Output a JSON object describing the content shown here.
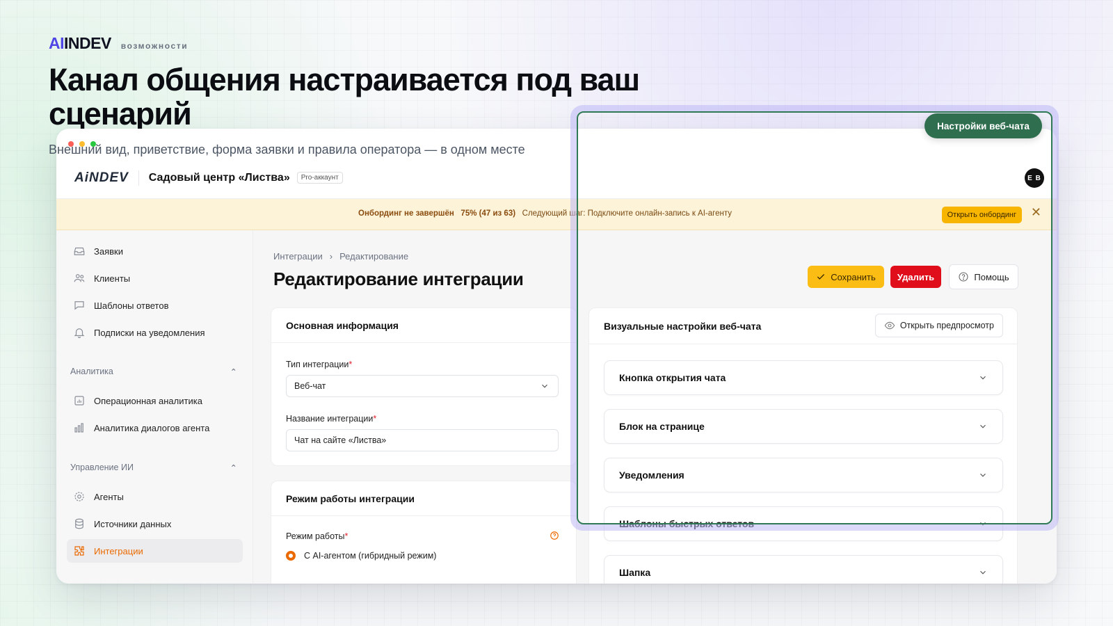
{
  "brand": {
    "logo_ai": "AI",
    "logo_rest": "INDEV",
    "tag": "возможности"
  },
  "hero": {
    "title": "Канал общения настраивается под ваш сценарий",
    "subtitle": "Внешний вид, приветствие, форма заявки и правила оператора — в одном месте"
  },
  "window_controls": {
    "colors": [
      "#ff5f57",
      "#febc2e",
      "#28c840"
    ]
  },
  "app": {
    "logo_ai": "Ai",
    "logo_rest": "NDEV",
    "org_name": "Садовый центр «Листва»",
    "plan_badge": "Pro-аккаунт",
    "avatar_initials": "E B"
  },
  "banner": {
    "title": "Онбординг не завершён",
    "progress": "75% (47 из 63)",
    "progress_value": 0.75,
    "next_step": "Следующий шаг: Подключите онлайн-запись к AI-агенту",
    "button": "Открыть онбординг",
    "close": "✕"
  },
  "sidebar": {
    "items": [
      {
        "label": "Заявки",
        "icon": "inbox-icon"
      },
      {
        "label": "Клиенты",
        "icon": "users-icon"
      },
      {
        "label": "Шаблоны ответов",
        "icon": "chat-icon"
      },
      {
        "label": "Подписки на уведомления",
        "icon": "bell-icon"
      }
    ],
    "analytics": {
      "title": "Аналитика",
      "items": [
        {
          "label": "Операционная аналитика",
          "icon": "chart-icon"
        },
        {
          "label": "Аналитика диалогов агента",
          "icon": "bars-icon"
        }
      ]
    },
    "ai": {
      "title": "Управление ИИ",
      "items": [
        {
          "label": "Агенты",
          "icon": "gear-icon"
        },
        {
          "label": "Источники данных",
          "icon": "database-icon"
        },
        {
          "label": "Интеграции",
          "icon": "puzzle-icon",
          "active": true
        }
      ]
    }
  },
  "page": {
    "breadcrumb": [
      "Интеграции",
      "Редактирование"
    ],
    "breadcrumb_sep": "›",
    "title": "Редактирование интеграции",
    "actions": {
      "save": "Сохранить",
      "delete": "Удалить",
      "help": "Помощь"
    }
  },
  "basic_info": {
    "title": "Основная информация",
    "type_label": "Тип интеграции",
    "type_value": "Веб-чат",
    "name_label": "Название интеграции",
    "name_value": "Чат на сайте «Листва»",
    "required_mark": "*"
  },
  "mode": {
    "title": "Режим работы интеграции",
    "label": "Режим работы",
    "option": "С AI-агентом (гибридный режим)"
  },
  "visual": {
    "title": "Визуальные настройки веб-чата",
    "preview_button": "Открыть предпросмотр",
    "sections": [
      "Кнопка открытия чата",
      "Блок на странице",
      "Уведомления",
      "Шаблоны быстрых ответов",
      "Шапка"
    ]
  },
  "highlight": {
    "label": "Настройки веб-чата",
    "color": "#2f6e4e"
  },
  "colors": {
    "accent": "#ea6a00",
    "save": "#fbbd14",
    "delete": "#e00d1a",
    "banner": "#fdf3d8"
  }
}
